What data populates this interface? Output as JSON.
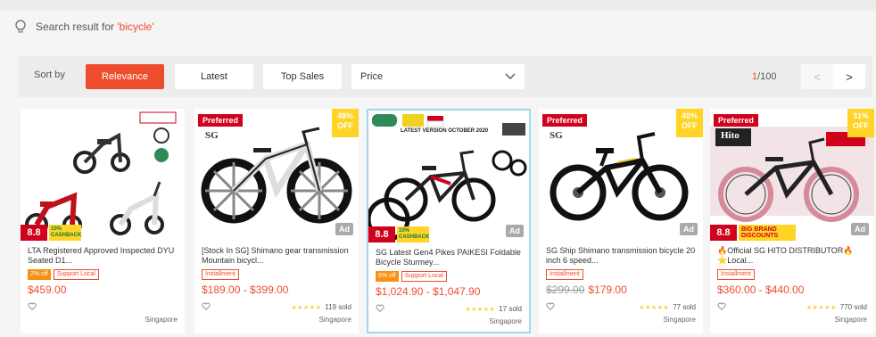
{
  "search": {
    "prefix": "Search result for ",
    "keyword": "'bicycle'"
  },
  "sort": {
    "label": "Sort by",
    "options": [
      "Relevance",
      "Latest",
      "Top Sales"
    ],
    "active": "Relevance",
    "price_label": "Price"
  },
  "pagination": {
    "current": "1",
    "total": "/100",
    "prev": "<",
    "next": ">"
  },
  "colors": {
    "accent": "#ee4d2d",
    "preferred": "#d0011b",
    "discount": "#ffd424"
  },
  "products": [
    {
      "title": "LTA Registered Approved Inspected DYU Seated D1...",
      "badge_off": "2% off",
      "badge_outline": "Support Local",
      "price": "$459.00",
      "old_price": "",
      "rating": "8.8",
      "cashback": "10% CASHBACK",
      "sold": "",
      "location": "Singapore"
    },
    {
      "preferred": "Preferred",
      "sg": "SG",
      "discount_pct": "48%",
      "discount_off": "OFF",
      "ad": "Ad",
      "title": "[Stock In SG] Shimano gear transmission Mountain bicycl...",
      "badge_outline": "Installment",
      "price": "$189.00 - $399.00",
      "old_price": "",
      "stars": "★★★★★",
      "sold": "119 sold",
      "location": "Singapore"
    },
    {
      "banner": "LATEST VERSION OCTOBER 2020",
      "ad": "Ad",
      "title": "SG Latest Gen4 Pikes PAIKESI Foldable Bicycle Sturmey...",
      "badge_off": "6% off",
      "badge_outline": "Support Local",
      "price": "$1,024.90 - $1,047.90",
      "old_price": "",
      "rating": "8.8",
      "cashback": "10% CASHBACK",
      "stars": "★★★★★",
      "sold": "17 sold",
      "location": "Singapore"
    },
    {
      "preferred": "Preferred",
      "sg": "SG",
      "discount_pct": "40%",
      "discount_off": "OFF",
      "ad": "Ad",
      "title": "SG Ship Shimano transmission bicycle 20 inch 6 speed...",
      "badge_outline": "Installment",
      "price": "$179.00",
      "old_price": "$299.00",
      "stars": "★★★★★",
      "sold": "77 sold",
      "location": "Singapore"
    },
    {
      "preferred": "Preferred",
      "sg": "Hito",
      "discount_pct": "31%",
      "discount_off": "OFF",
      "ad": "Ad",
      "title": "🔥Official SG HITO DISTRIBUTOR🔥 ⭐Local...",
      "badge_outline": "Installment",
      "price": "$360.00 - $440.00",
      "old_price": "",
      "rating": "8.8",
      "brand": "BIG BRAND DISCOUNTS",
      "stars": "★★★★★",
      "sold": "770 sold",
      "location": "Singapore"
    }
  ]
}
